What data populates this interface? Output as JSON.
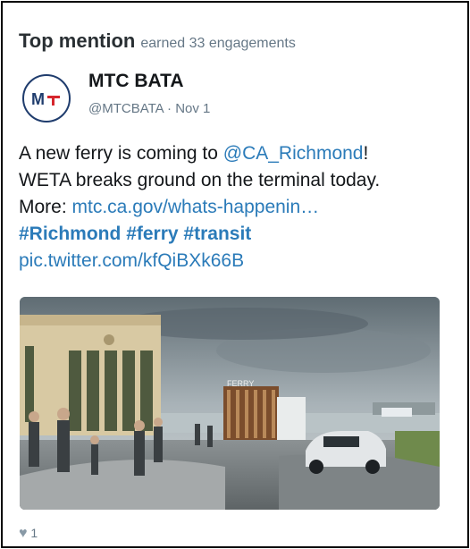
{
  "header": {
    "title": "Top mention",
    "subtitle": "earned 33 engagements"
  },
  "author": {
    "avatar_icon": "mtc-logo-icon",
    "name": "MTC BATA",
    "handle": "@MTCBATA",
    "separator": "·",
    "date": "Nov 1"
  },
  "tweet": {
    "part1": "A new ferry is coming to ",
    "mention": "@CA_Richmond",
    "part1_end": "!",
    "line2": "WETA breaks ground on the terminal today.",
    "more_label": "More: ",
    "link": "mtc.ca.gov/whats-happenin…",
    "hashtags": [
      "#Richmond",
      "#ferry",
      "#transit"
    ],
    "pic_link": "pic.twitter.com/kfQiBXk66B"
  },
  "media": {
    "sign_text": "FERRY",
    "alt_icon": "ferry-terminal-rendering-image"
  },
  "footer": {
    "like_icon": "heart-icon",
    "like_count": "1"
  },
  "colors": {
    "link": "#2b7bb9",
    "muted": "#657786",
    "brand_red": "#d6262d",
    "brand_navy": "#1f3c6d"
  }
}
